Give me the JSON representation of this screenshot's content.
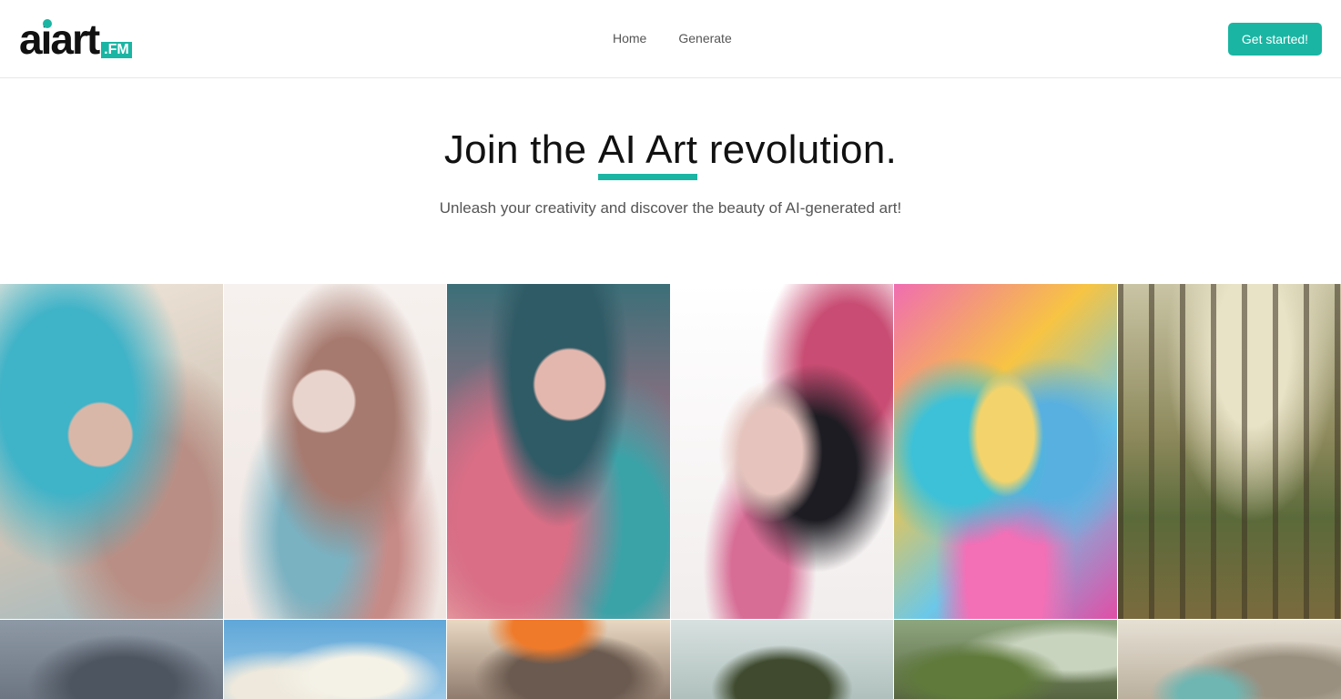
{
  "brand": {
    "name": "aiart",
    "suffix": ".FM"
  },
  "nav": {
    "links": [
      {
        "label": "Home"
      },
      {
        "label": "Generate"
      }
    ],
    "cta_label": "Get started!"
  },
  "hero": {
    "title_before": "Join the ",
    "title_highlight": "AI Art",
    "title_after": " revolution.",
    "subtitle": "Unleash your creativity and discover the beauty of AI-generated art!"
  },
  "colors": {
    "accent": "#1ab5a3",
    "text": "#111111",
    "muted": "#555555"
  },
  "gallery": {
    "rows": 2,
    "images": [
      "turquoise-floral-woman-portrait",
      "pastel-floral-woman-portrait",
      "pink-teal-leaf-woman-portrait",
      "ink-splatter-face-portrait",
      "psychedelic-pop-art-girl",
      "sunlit-forest-scene",
      "grey-character-closeup",
      "sky-clouds-scene",
      "orange-haired-creature",
      "rock-island-landscape",
      "mossy-forest-ruins",
      "misty-mountain-waterfall"
    ]
  }
}
